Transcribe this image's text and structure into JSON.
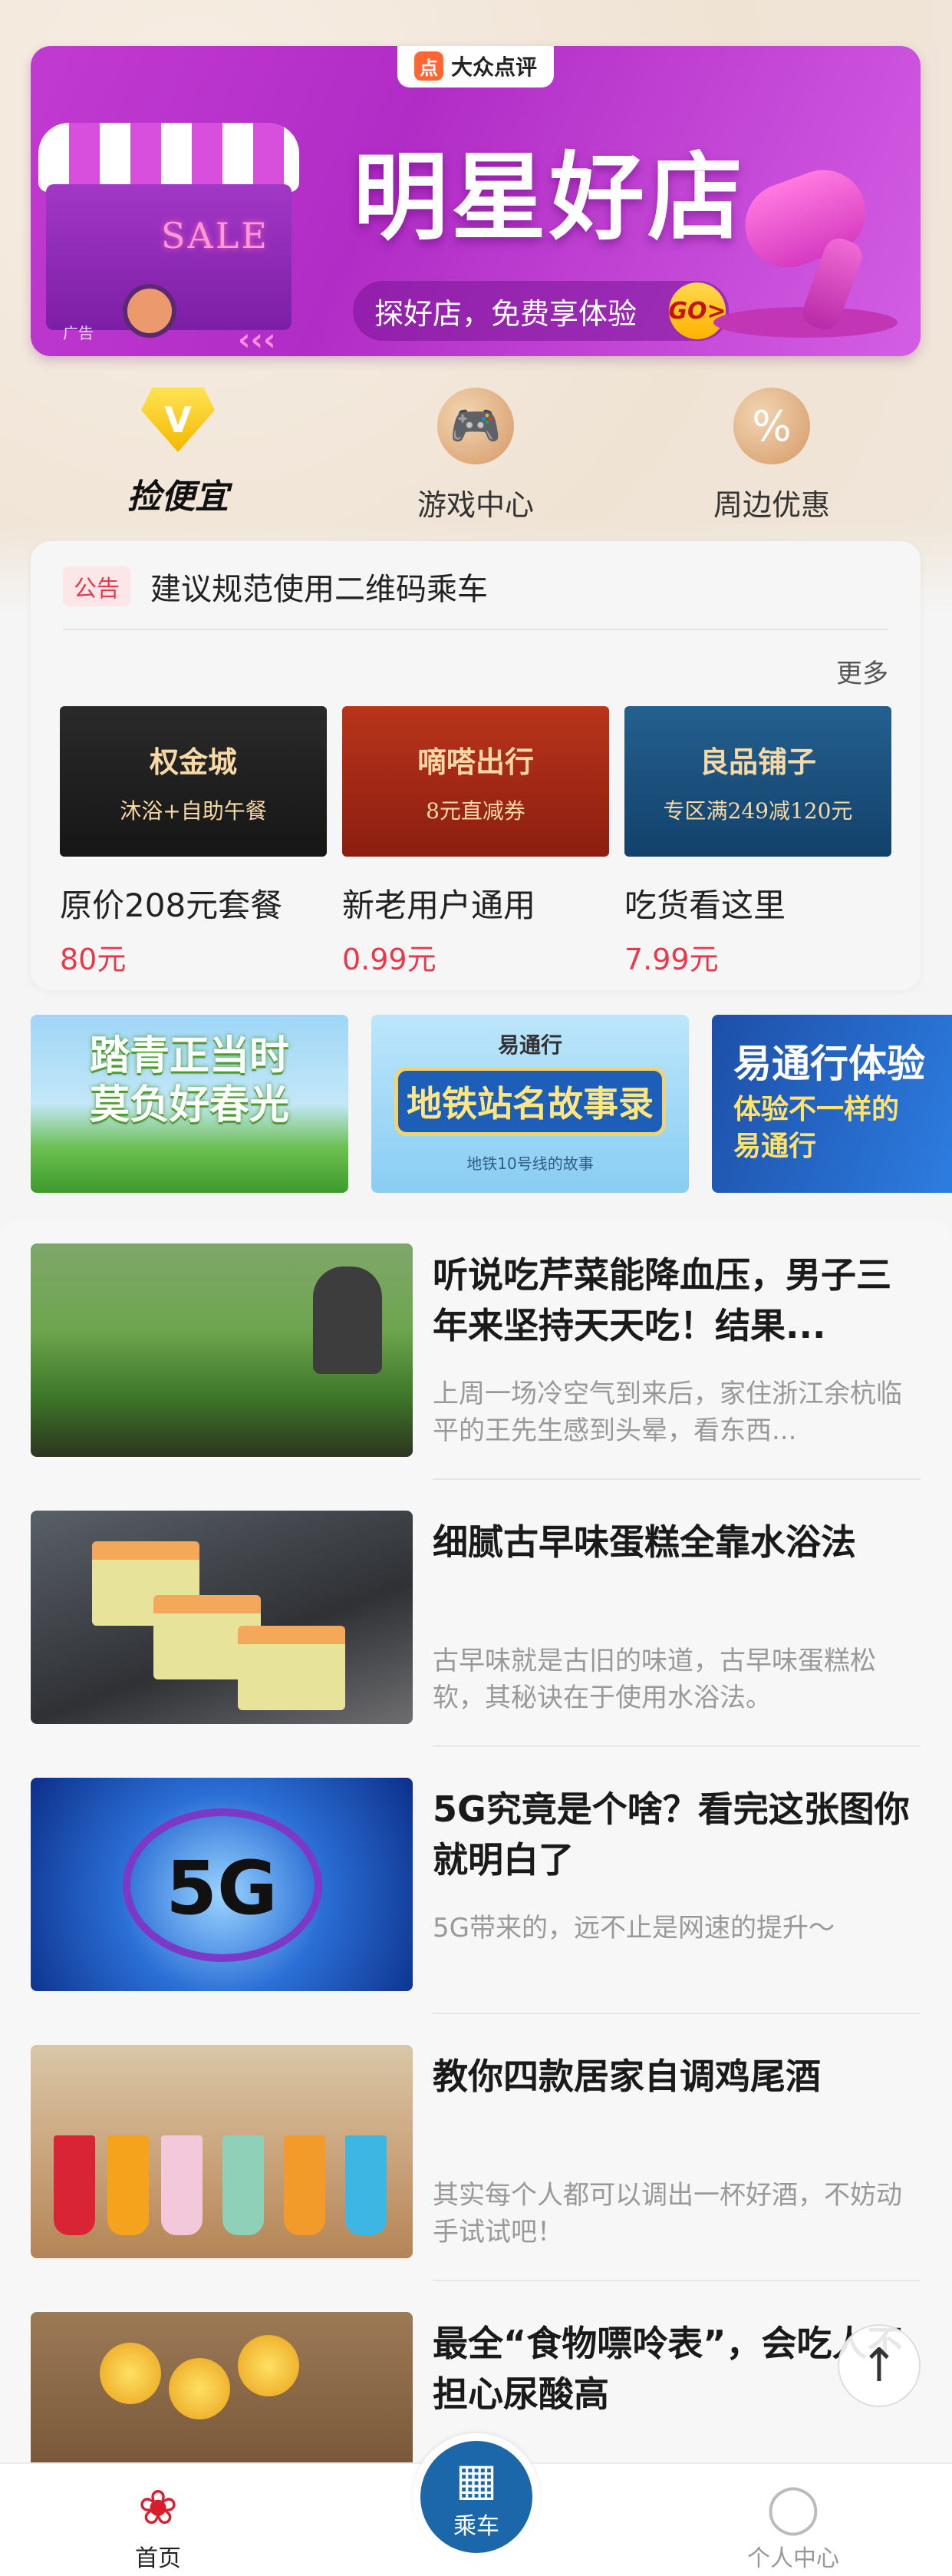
{
  "banner": {
    "brand": "大众点评",
    "brand_logo": "点",
    "title": "明星好店",
    "slogan": "探好店，免费享体验",
    "go_label": "GO>",
    "sale_text": "SALE",
    "ad_tag": "广告"
  },
  "quick_links": [
    {
      "label": "捡便宜",
      "icon": "v-diamond-icon",
      "glyph": "V"
    },
    {
      "label": "游戏中心",
      "icon": "gamepad-icon",
      "glyph": "🎮"
    },
    {
      "label": "周边优惠",
      "icon": "percent-icon",
      "glyph": "%"
    }
  ],
  "notice": {
    "tag": "公告",
    "text": "建议规范使用二维码乘车"
  },
  "deals": {
    "more_label": "更多",
    "items": [
      {
        "brand": "权金城",
        "offer": "沐浴+自助午餐",
        "name": "原价208元套餐",
        "price": "80元"
      },
      {
        "brand": "嘀嗒出行",
        "offer": "8元直减券",
        "name": "新老用户通用",
        "price": "0.99元"
      },
      {
        "brand": "良品铺子",
        "offer": "专区满249减120元",
        "name": "吃货看这里",
        "price": "7.99元"
      }
    ]
  },
  "promos": [
    {
      "line1": "踏青正当时",
      "line2": "莫负好春光"
    },
    {
      "brand": "易通行",
      "title": "地铁站名故事录",
      "sub": "地铁10号线的故事"
    },
    {
      "title": "易通行体验",
      "line1": "体验不一样的",
      "line2": "易通行"
    }
  ],
  "articles": [
    {
      "title": "听说吃芹菜能降血压，男子三年来坚持天天吃！结果...",
      "desc": "上周一场冷空气到来后，家住浙江余杭临平的王先生感到头晕，看东西..."
    },
    {
      "title": "细腻古早味蛋糕全靠水浴法",
      "desc": "古早味就是古旧的味道，古早味蛋糕松软，其秘诀在于使用水浴法。"
    },
    {
      "title": "5G究竟是个啥？看完这张图你就明白了",
      "desc": "5G带来的，远不止是网速的提升～",
      "thumb_text": "5G"
    },
    {
      "title": "教你四款居家自调鸡尾酒",
      "desc": "其实每个人都可以调出一杯好酒，不妨动手试试吧！"
    },
    {
      "title": "最全“食物嘌呤表”，会吃人不担心尿酸高",
      "desc": ""
    }
  ],
  "bottom_nav": {
    "home": "首页",
    "ride": "乘车",
    "profile": "个人中心"
  },
  "colors": {
    "accent_red": "#e8394a",
    "nav_blue": "#1c67a9",
    "banner_purple": "#c13bd2"
  }
}
